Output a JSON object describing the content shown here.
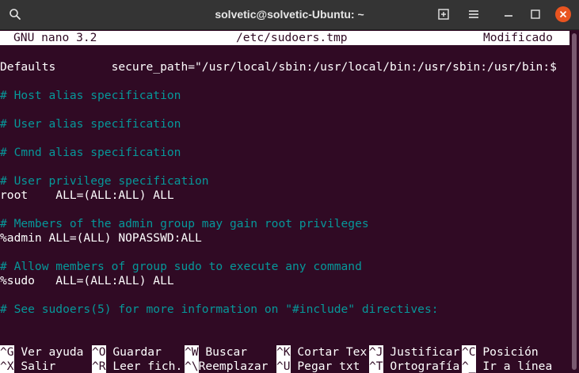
{
  "window": {
    "title": "solvetic@solvetic-Ubuntu: ~",
    "colors": {
      "titlebar": "#343434",
      "background": "#300a24",
      "close": "#e95420",
      "comment": "#06989a"
    }
  },
  "nano": {
    "version": "GNU nano 3.2",
    "filename": "/etc/sudoers.tmp",
    "status": "Modificado"
  },
  "lines": [
    {
      "text": "Defaults        secure_path=\"/usr/local/sbin:/usr/local/bin:/usr/sbin:/usr/bin:$",
      "comment": false
    },
    {
      "text": "# Host alias specification",
      "comment": true
    },
    {
      "text": "# User alias specification",
      "comment": true
    },
    {
      "text": "# Cmnd alias specification",
      "comment": true
    },
    {
      "text": "# User privilege specification",
      "comment": true
    },
    {
      "text": "root    ALL=(ALL:ALL) ALL",
      "comment": false
    },
    {
      "text": "# Members of the admin group may gain root privileges",
      "comment": true
    },
    {
      "text": "%admin ALL=(ALL) NOPASSWD:ALL",
      "comment": false
    },
    {
      "text": "# Allow members of group sudo to execute any command",
      "comment": true
    },
    {
      "text": "%sudo   ALL=(ALL:ALL) ALL",
      "comment": false
    },
    {
      "text": "# See sudoers(5) for more information on \"#include\" directives:",
      "comment": true
    }
  ],
  "shortcuts_row1": [
    {
      "key": "^G",
      "label": "Ver ayuda"
    },
    {
      "key": "^O",
      "label": "Guardar"
    },
    {
      "key": "^W",
      "label": "Buscar"
    },
    {
      "key": "^K",
      "label": "Cortar Tex"
    },
    {
      "key": "^J",
      "label": "Justificar"
    },
    {
      "key": "^C",
      "label": "Posición"
    }
  ],
  "shortcuts_row2": [
    {
      "key": "^X",
      "label": "Salir"
    },
    {
      "key": "^R",
      "label": "Leer fich."
    },
    {
      "key": "^\\",
      "label": "Reemplazar"
    },
    {
      "key": "^U",
      "label": "Pegar txt"
    },
    {
      "key": "^T",
      "label": "Ortografía"
    },
    {
      "key": "^_",
      "label": "Ir a línea"
    }
  ],
  "icons": [
    "search-icon",
    "new-tab-icon",
    "menu-icon",
    "minimize-icon",
    "maximize-icon",
    "close-icon"
  ]
}
